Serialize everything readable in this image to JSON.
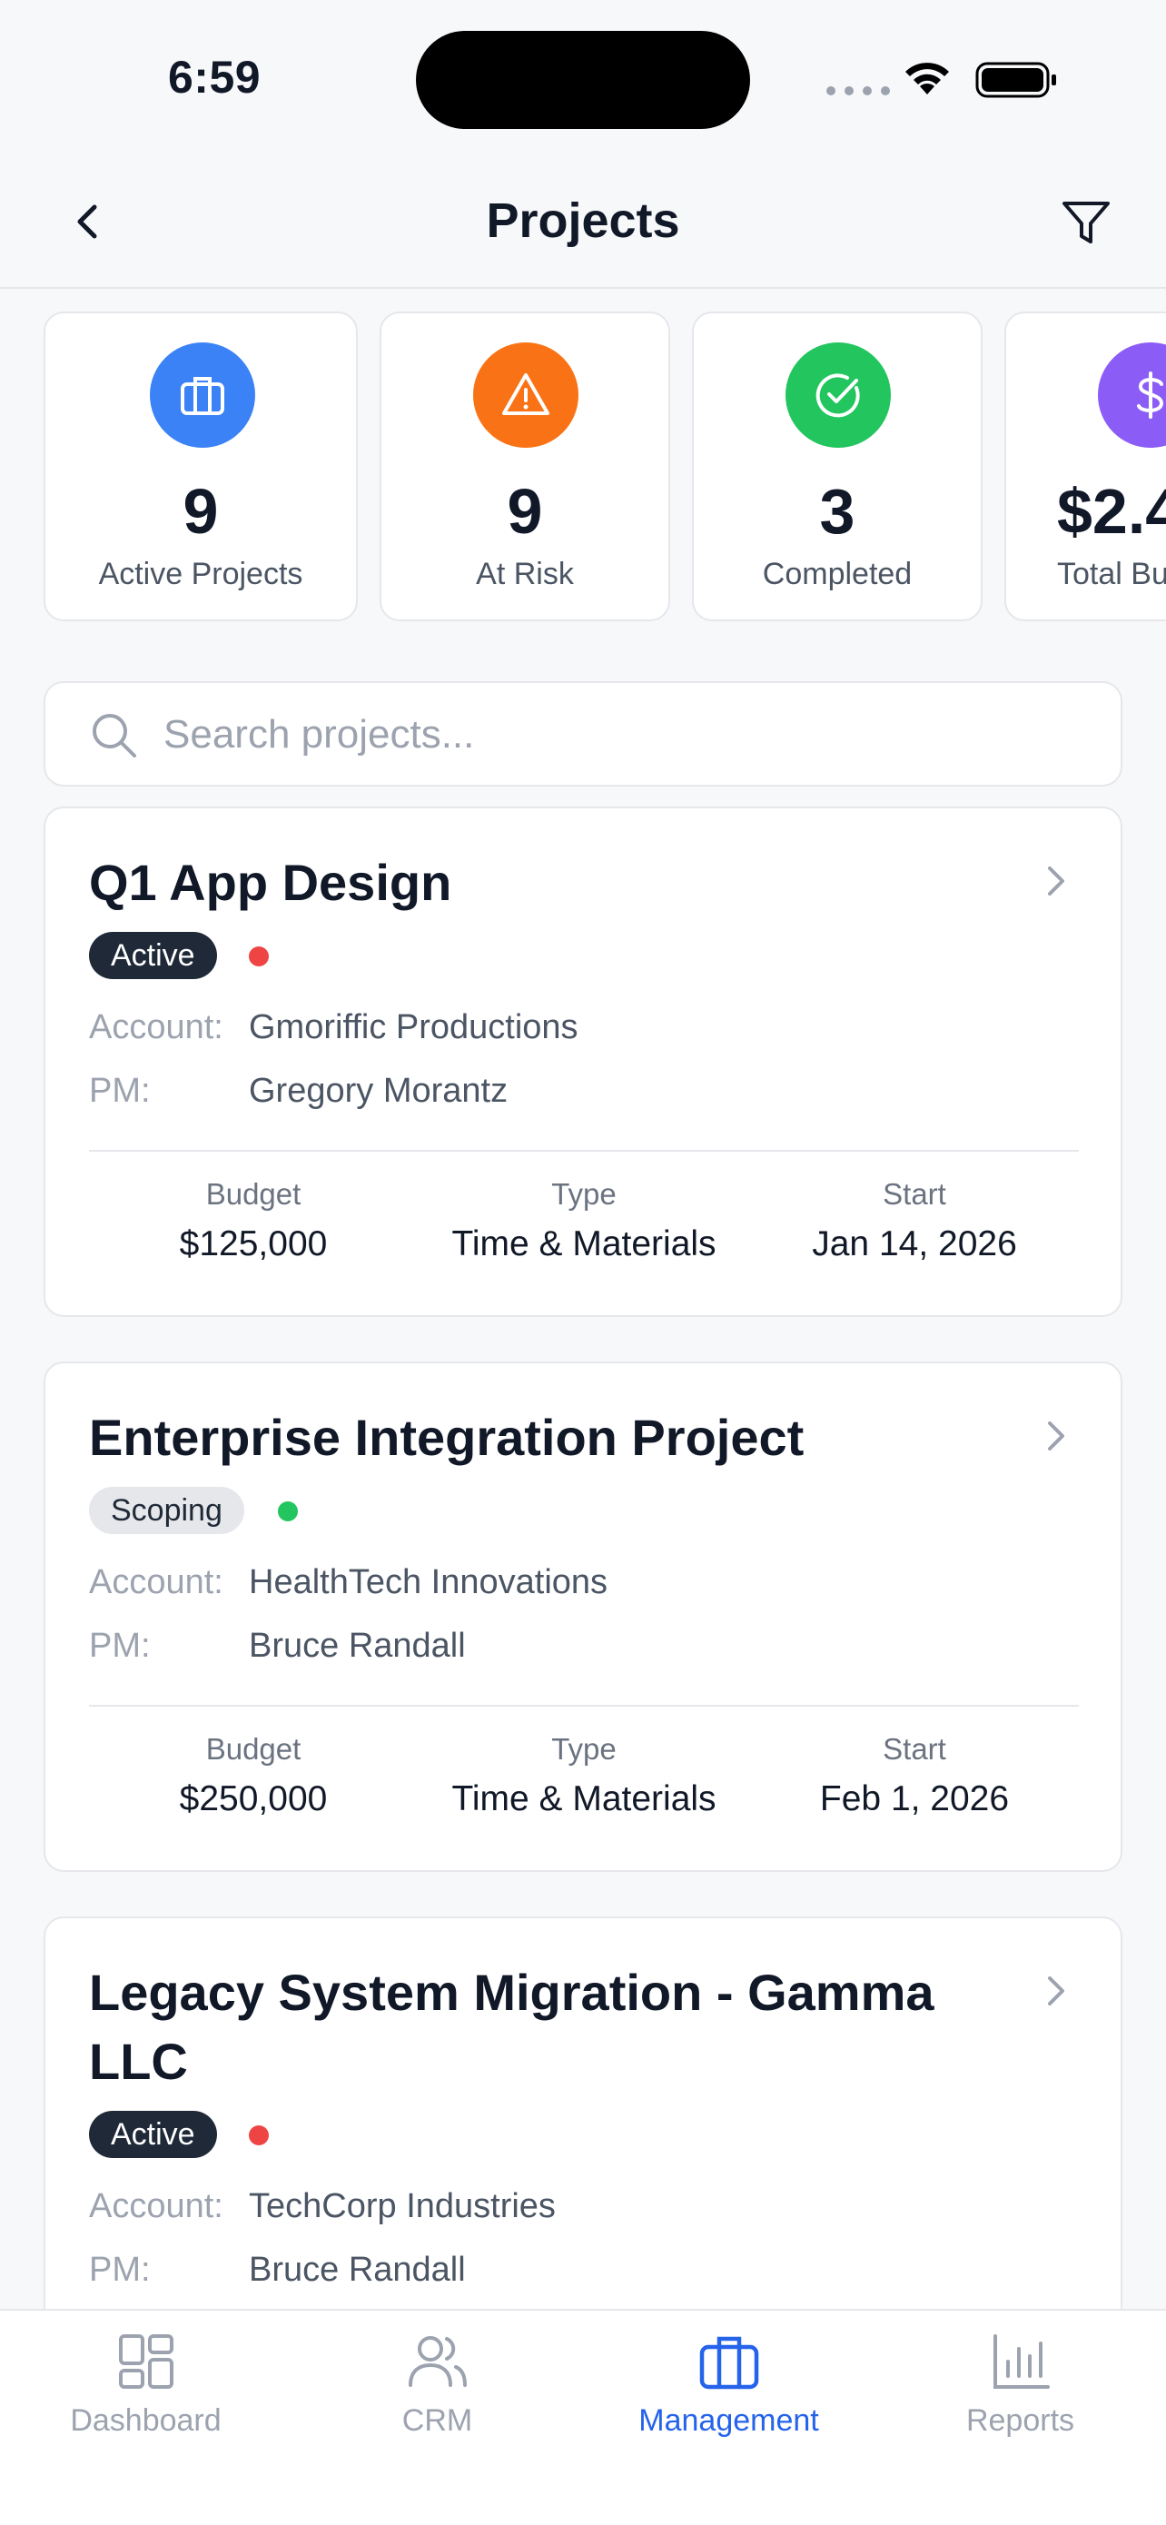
{
  "status_bar": {
    "time": "6:59"
  },
  "nav": {
    "title": "Projects"
  },
  "stats": [
    {
      "value": "9",
      "label": "Active Projects",
      "icon": "briefcase-icon",
      "color": "#3b82f6"
    },
    {
      "value": "9",
      "label": "At Risk",
      "icon": "warning-icon",
      "color": "#f97316"
    },
    {
      "value": "3",
      "label": "Completed",
      "icon": "check-circle-icon",
      "color": "#22c55e"
    },
    {
      "value": "$2.4",
      "label": "Total Bu",
      "icon": "dollar-icon",
      "color": "#8b5cf6"
    }
  ],
  "search": {
    "placeholder": "Search projects..."
  },
  "labels": {
    "account": "Account:",
    "pm": "PM:",
    "budget": "Budget",
    "type": "Type",
    "start": "Start"
  },
  "projects": [
    {
      "title": "Q1 App Design",
      "status": "Active",
      "health_color": "#ef4444",
      "account": "Gmoriffic Productions",
      "pm": "Gregory Morantz",
      "budget": "$125,000",
      "type": "Time & Materials",
      "start": "Jan 14, 2026"
    },
    {
      "title": "Enterprise Integration Project",
      "status": "Scoping",
      "health_color": "#22c55e",
      "account": "HealthTech Innovations",
      "pm": "Bruce Randall",
      "budget": "$250,000",
      "type": "Time & Materials",
      "start": "Feb 1, 2026"
    },
    {
      "title": "Legacy System Migration - Gamma LLC",
      "status": "Active",
      "health_color": "#ef4444",
      "account": "TechCorp Industries",
      "pm": "Bruce Randall"
    }
  ],
  "tabs": [
    {
      "label": "Dashboard",
      "icon": "dashboard-icon",
      "active": false
    },
    {
      "label": "CRM",
      "icon": "users-icon",
      "active": false
    },
    {
      "label": "Management",
      "icon": "briefcase-icon",
      "active": true
    },
    {
      "label": "Reports",
      "icon": "bar-chart-icon",
      "active": false
    }
  ],
  "colors": {
    "accent": "#2563eb",
    "active_badge": "#1f2937"
  }
}
